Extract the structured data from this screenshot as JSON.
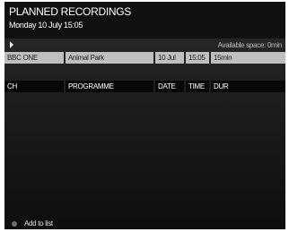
{
  "header": {
    "title": "PLANNED RECORDINGS",
    "subtitle": "Monday 10 July 15:05"
  },
  "status": {
    "available_space": "Available space: 0min"
  },
  "recordings": [
    {
      "channel": "BBC ONE",
      "programme": "Animal Park",
      "date": "10 Jul",
      "time": "15:05",
      "duration": "15min"
    }
  ],
  "table_headers": {
    "channel": "CH",
    "programme": "PROGRAMME",
    "date": "DATE",
    "time": "TIME",
    "duration": "DUR"
  },
  "footer": {
    "action_label": "Add to list",
    "action_icon": "grey-button-icon"
  },
  "colors": {
    "selected_row": "#bfbfbf",
    "header_bar": "#080808",
    "background": "#1a1a1a"
  }
}
